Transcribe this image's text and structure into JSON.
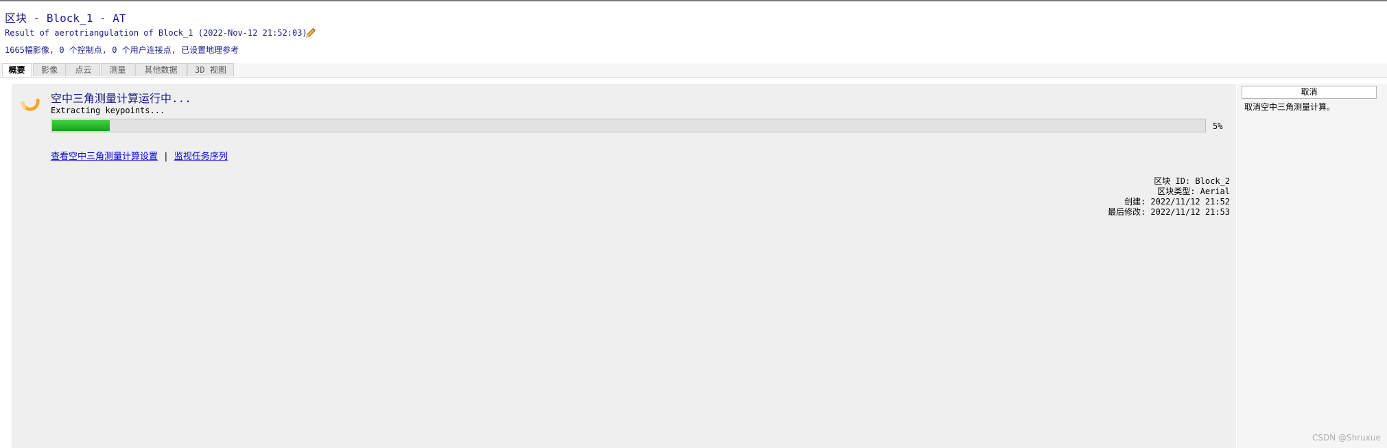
{
  "header": {
    "title": "区块 - Block_1 - AT",
    "subtitle": "Result of aerotriangulation of Block_1 (2022-Nov-12 21:52:03)",
    "summary": "1665幅影像, 0 个控制点, 0 个用户连接点, 已设置地理参考"
  },
  "tabs": [
    {
      "label": "概要",
      "active": true
    },
    {
      "label": "影像",
      "active": false
    },
    {
      "label": "点云",
      "active": false
    },
    {
      "label": "测量",
      "active": false
    },
    {
      "label": "其他数据",
      "active": false
    },
    {
      "label": "3D 视图",
      "active": false
    }
  ],
  "status": {
    "title": "空中三角测量计算运行中...",
    "step": "Extracting keypoints...",
    "progress_percent": 5,
    "progress_label": "5%"
  },
  "links": {
    "settings": "查看空中三角测量计算设置",
    "separator": "|",
    "monitor": "监视任务序列"
  },
  "meta": {
    "block_id": "区块 ID: Block_2",
    "block_type": "区块类型: Aerial",
    "created": "创建: 2022/11/12 21:52",
    "modified": "最后修改: 2022/11/12 21:53"
  },
  "sidebar": {
    "cancel_label": "取消",
    "cancel_description": "取消空中三角测量计算。"
  },
  "watermark": "CSDN @Shruxue",
  "colors": {
    "title_text": "#1a1a8c",
    "progress_fill": "#2fbf2f",
    "spinner": "#f5a623",
    "link": "#0000ee"
  },
  "icons": {
    "edit": "pencil-icon",
    "spinner": "loading-spinner-icon"
  }
}
